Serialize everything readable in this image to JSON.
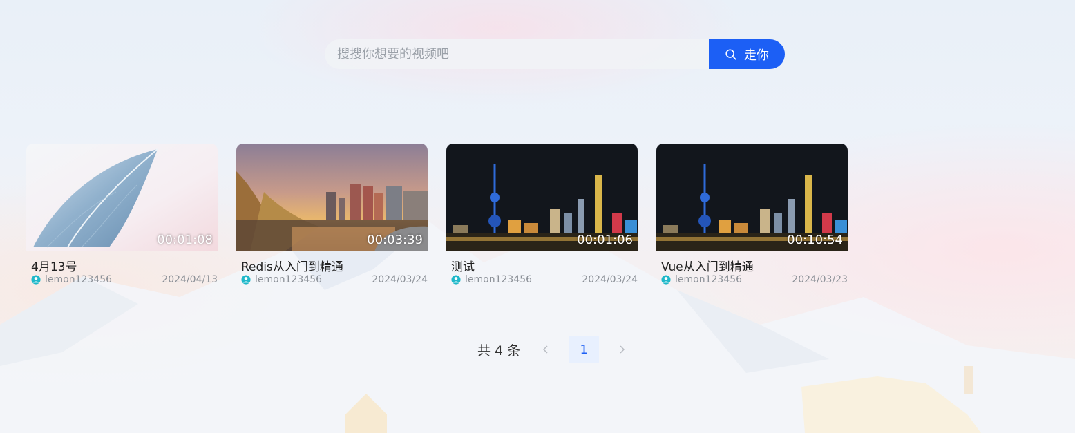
{
  "search": {
    "placeholder": "搜搜你想要的视频吧",
    "button_label": "走你"
  },
  "videos": [
    {
      "title": "4月13号",
      "author": "lemon123456",
      "date": "2024/04/13",
      "duration": "00:01:08",
      "thumbnail": "feather"
    },
    {
      "title": "Redis从入门到精通",
      "author": "lemon123456",
      "date": "2024/03/24",
      "duration": "00:03:39",
      "thumbnail": "city-sunset"
    },
    {
      "title": "测试",
      "author": "lemon123456",
      "date": "2024/03/24",
      "duration": "00:01:06",
      "thumbnail": "city-night"
    },
    {
      "title": "Vue从入门到精通",
      "author": "lemon123456",
      "date": "2024/03/23",
      "duration": "00:10:54",
      "thumbnail": "city-night"
    }
  ],
  "pagination": {
    "total_label": "共 4 条",
    "current_page": "1"
  },
  "colors": {
    "accent": "#1c5ff5",
    "author_icon": "#1fb8c9"
  },
  "icons": {
    "search": "search-icon",
    "author": "user-circle-icon",
    "prev": "chevron-left-icon",
    "next": "chevron-right-icon"
  }
}
